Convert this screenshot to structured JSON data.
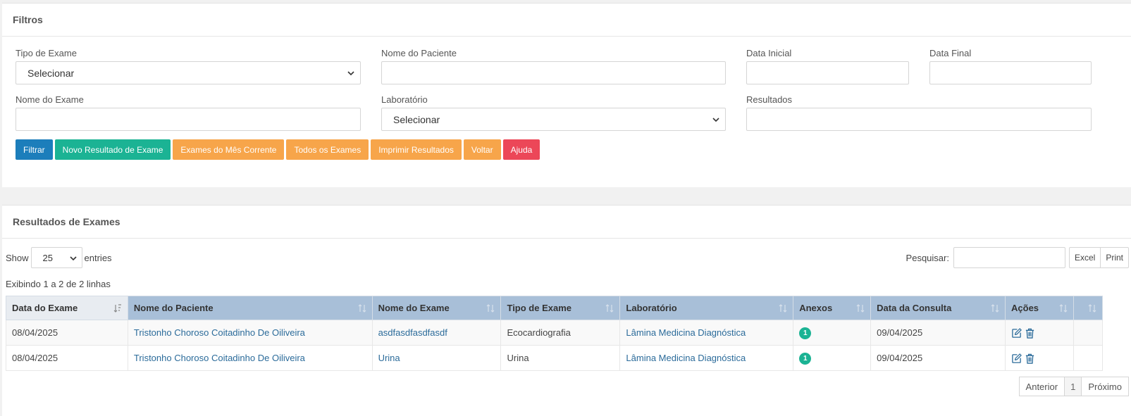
{
  "filters": {
    "title": "Filtros",
    "tipo_exame": {
      "label": "Tipo de Exame",
      "value": "Selecionar"
    },
    "nome_paciente": {
      "label": "Nome do Paciente",
      "value": ""
    },
    "data_inicial": {
      "label": "Data Inicial",
      "value": ""
    },
    "data_final": {
      "label": "Data Final",
      "value": ""
    },
    "nome_exame": {
      "label": "Nome do Exame",
      "value": ""
    },
    "laboratorio": {
      "label": "Laboratório",
      "value": "Selecionar"
    },
    "resultados": {
      "label": "Resultados",
      "value": ""
    },
    "buttons": {
      "filtrar": "Filtrar",
      "novo": "Novo Resultado de Exame",
      "mes_corrente": "Exames do Mês Corrente",
      "todos": "Todos os Exames",
      "imprimir": "Imprimir Resultados",
      "voltar": "Voltar",
      "ajuda": "Ajuda"
    }
  },
  "results": {
    "title": "Resultados de Exames",
    "show_label": "Show",
    "show_value": "25",
    "entries_label": "entries",
    "search_label": "Pesquisar:",
    "excel": "Excel",
    "print": "Print",
    "info": "Exibindo 1 a 2 de 2 linhas",
    "columns": [
      "Data do Exame",
      "Nome do Paciente",
      "Nome do Exame",
      "Tipo de Exame",
      "Laboratório",
      "Anexos",
      "Data da Consulta",
      "Ações",
      ""
    ],
    "rows": [
      {
        "data_exame": "08/04/2025",
        "paciente": "Tristonho Choroso Coitadinho De Oiliveira",
        "exame": "asdfasdfasdfasdf",
        "tipo": "Ecocardiografia",
        "laboratorio": "Lâmina Medicina Diagnóstica",
        "anexos": "1",
        "data_consulta": "09/04/2025"
      },
      {
        "data_exame": "08/04/2025",
        "paciente": "Tristonho Choroso Coitadinho De Oiliveira",
        "exame": "Urina",
        "tipo": "Urina",
        "laboratorio": "Lâmina Medicina Diagnóstica",
        "anexos": "1",
        "data_consulta": "09/04/2025"
      }
    ],
    "pagination": {
      "prev": "Anterior",
      "current": "1",
      "next": "Próximo"
    }
  },
  "colors": {
    "blue": "#1c7ebb",
    "green": "#1bb394",
    "orange": "#f7a54a",
    "red": "#ec4758",
    "header": "#a8bfd8",
    "link": "#2b6b9a"
  },
  "icons": [
    "chevron-down-icon",
    "sort-icon",
    "sort-asc-icon",
    "edit-icon",
    "trash-icon"
  ]
}
